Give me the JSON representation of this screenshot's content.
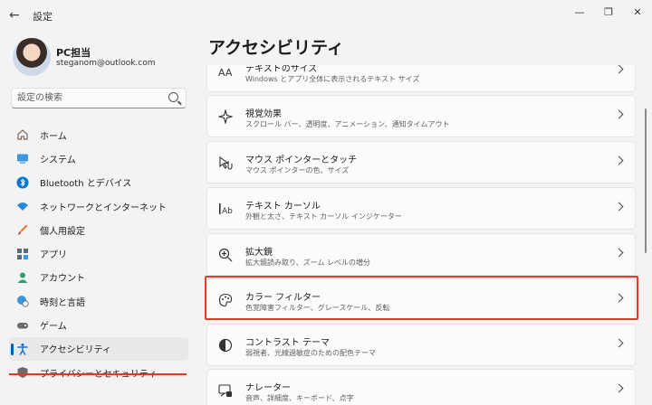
{
  "window": {
    "title": "設定"
  },
  "user": {
    "name": "PC担当",
    "email": "steganom@outlook.com"
  },
  "search": {
    "placeholder": "設定の検索"
  },
  "nav": {
    "items": [
      {
        "label": "ホーム",
        "icon": "home-icon"
      },
      {
        "label": "システム",
        "icon": "system-icon"
      },
      {
        "label": "Bluetooth とデバイス",
        "icon": "bluetooth-icon"
      },
      {
        "label": "ネットワークとインターネット",
        "icon": "network-icon"
      },
      {
        "label": "個人用設定",
        "icon": "brush-icon"
      },
      {
        "label": "アプリ",
        "icon": "apps-icon"
      },
      {
        "label": "アカウント",
        "icon": "account-icon"
      },
      {
        "label": "時刻と言語",
        "icon": "globe-clock-icon"
      },
      {
        "label": "ゲーム",
        "icon": "gamepad-icon"
      },
      {
        "label": "アクセシビリティ",
        "icon": "accessibility-icon",
        "active": true
      },
      {
        "label": "プライバシーとセキュリティ",
        "icon": "shield-icon"
      }
    ]
  },
  "page": {
    "title": "アクセシビリティ"
  },
  "cards": [
    {
      "title": "テキストのサイズ",
      "subtitle": "Windows とアプリ全体に表示されるテキスト サイズ",
      "icon": "text-size-icon"
    },
    {
      "title": "視覚効果",
      "subtitle": "スクロール バー、透明度、アニメーション、通知タイムアウト",
      "icon": "visual-effects-icon"
    },
    {
      "title": "マウス ポインターとタッチ",
      "subtitle": "マウス ポインターの色、サイズ",
      "icon": "mouse-pointer-icon"
    },
    {
      "title": "テキスト カーソル",
      "subtitle": "外観と太さ、テキスト カーソル インジケーター",
      "icon": "text-cursor-icon"
    },
    {
      "title": "拡大鏡",
      "subtitle": "拡大鏡読み取り、ズーム レベルの増分",
      "icon": "magnifier-icon"
    },
    {
      "title": "カラー フィルター",
      "subtitle": "色覚障害フィルター、グレースケール、反転",
      "icon": "palette-icon",
      "highlighted": true
    },
    {
      "title": "コントラスト テーマ",
      "subtitle": "弱視者、光線過敏症のための配色テーマ",
      "icon": "contrast-icon"
    },
    {
      "title": "ナレーター",
      "subtitle": "音声、詳細度、キーボード、点字",
      "icon": "narrator-icon"
    }
  ],
  "colors": {
    "accent": "#005fb8",
    "highlight": "#e23c2a"
  }
}
